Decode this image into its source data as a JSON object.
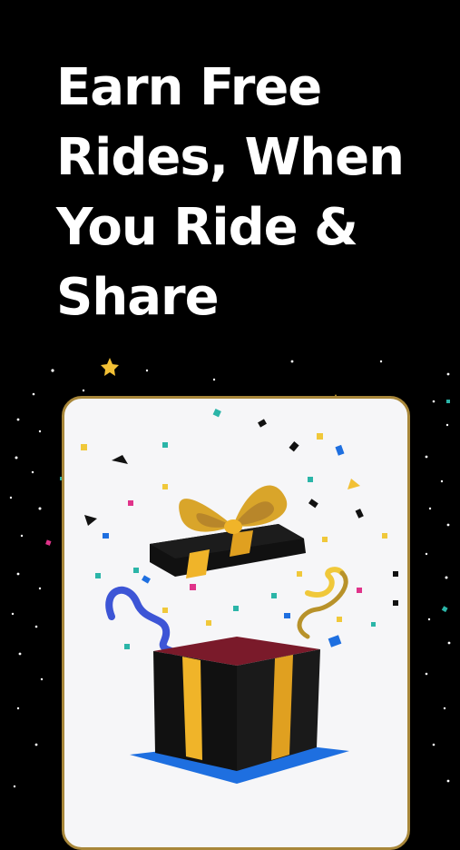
{
  "headline": {
    "line1": "Earn Free",
    "line2": "Rides, When",
    "line3": "You Ride &",
    "line4": "Share"
  },
  "colors": {
    "background": "#000000",
    "headline": "#ffffff",
    "card_background": "#f6f6f8",
    "card_border": "#a8873a",
    "gift_box": "#111111",
    "ribbon": "#f0b429",
    "box_inner": "#7a1a2a",
    "shadow": "#1e6fe0"
  },
  "illustration": {
    "icon": "gift-box-icon"
  }
}
